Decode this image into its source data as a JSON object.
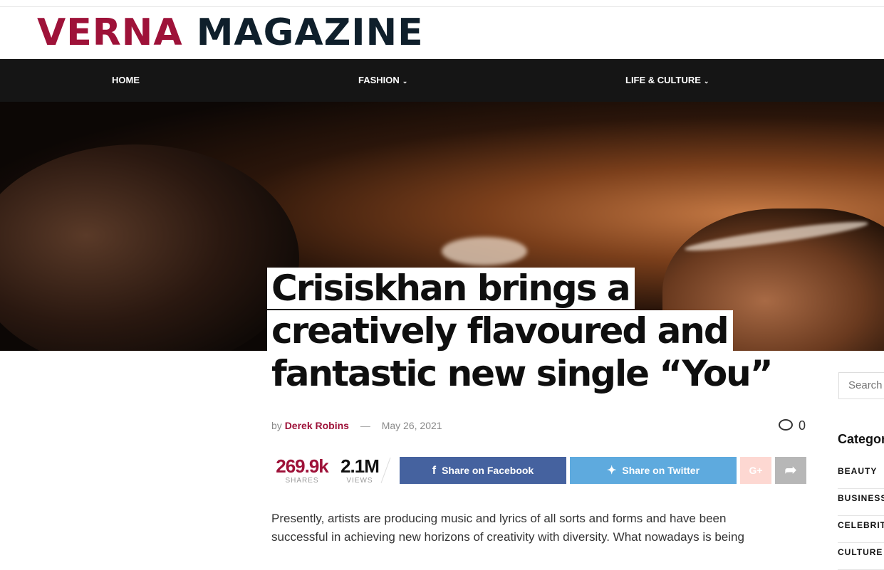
{
  "site": {
    "logo_part1": "VERNA",
    "logo_part2": "MAGAZINE"
  },
  "nav": {
    "items": [
      {
        "label": "HOME"
      },
      {
        "label": "FASHION"
      },
      {
        "label": "LIFE & CULTURE"
      }
    ]
  },
  "article": {
    "title_lines": [
      "Crisiskhan brings a",
      "creatively flavoured and",
      "fantastic new single “You”"
    ],
    "by": "by",
    "author": "Derek Robins",
    "date": "May 26, 2021",
    "comments": "0",
    "shares_count": "269.9k",
    "shares_label": "SHARES",
    "views_count": "2.1M",
    "views_label": "VIEWS",
    "body": "Presently, artists are producing music and lyrics of all sorts and forms and have been successful in achieving new horizons of creativity with diversity. What nowadays is being"
  },
  "share": {
    "facebook": "Share on Facebook",
    "twitter": "Share on Twitter",
    "gplus": "G+"
  },
  "sidebar": {
    "search_placeholder": "Search",
    "categories_title": "Categories",
    "categories": [
      "BEAUTY",
      "BUSINESS",
      "CELEBRITY",
      "CULTURE"
    ]
  },
  "colors": {
    "brand": "#9e1239",
    "nav_bg": "#151515",
    "facebook": "#45629f",
    "twitter": "#5eaade"
  },
  "icons": [
    "facebook-icon",
    "twitter-icon",
    "comment-icon",
    "share-arrow-icon",
    "chevron-down-icon"
  ]
}
